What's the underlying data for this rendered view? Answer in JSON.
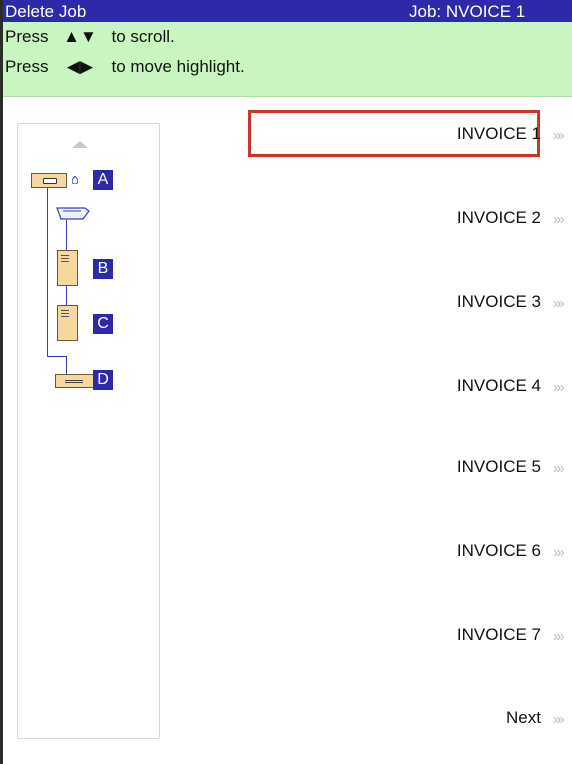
{
  "title_bar": {
    "left": "Delete Job",
    "right": "Job:  NVOICE 1"
  },
  "instructions": {
    "line1_prefix": "Press",
    "line1_arrows": "▲▼",
    "line1_suffix": "to scroll.",
    "line2_prefix": "Press",
    "line2_arrows": "◀▶",
    "line2_suffix": "to move highlight."
  },
  "diagram": {
    "labels": [
      "A",
      "B",
      "C",
      "D"
    ]
  },
  "list": {
    "items": [
      "INVOICE 1",
      "INVOICE 2",
      "INVOICE 3",
      "INVOICE 4",
      "INVOICE 5",
      "INVOICE 6",
      "INVOICE 7"
    ],
    "next_label": "Next",
    "selected_index": 0
  },
  "icons": {
    "scroll_up": "scroll-up-icon",
    "item_arrow": "double-chevron-right-icon",
    "tray": "feeder-tray-icon",
    "folder": "folder-icon",
    "sheet": "sheet-icon",
    "envelope": "envelope-icon"
  },
  "colors": {
    "title_bar": "#2c2aa8",
    "instructions_bg": "#c8f5c0",
    "highlight": "#c8372a",
    "badge": "#2c2aa8",
    "paper": "#f6d79f"
  }
}
